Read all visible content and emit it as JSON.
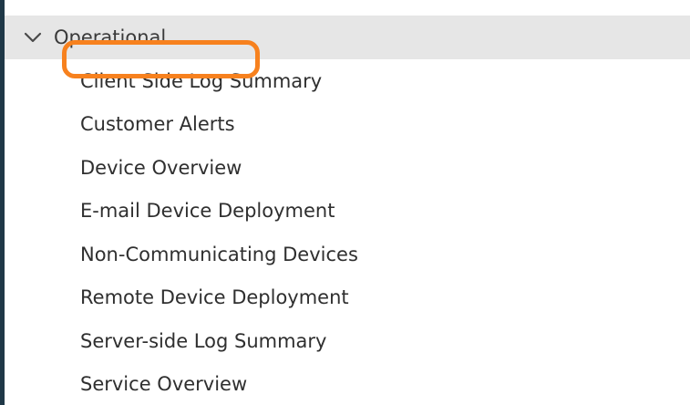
{
  "colors": {
    "header_background": "#e6e6e6",
    "left_edge": "#1f3847",
    "highlight": "#f7811e",
    "text": "#2f2f2f"
  },
  "section": {
    "title": "Operational",
    "expanded": true,
    "icon": "chevron-down-icon"
  },
  "reports": [
    {
      "label": "Client Side Log Summary",
      "highlighted": false
    },
    {
      "label": "Customer Alerts",
      "highlighted": true
    },
    {
      "label": "Device Overview",
      "highlighted": false
    },
    {
      "label": "E-mail Device Deployment",
      "highlighted": false
    },
    {
      "label": "Non-Communicating Devices",
      "highlighted": false
    },
    {
      "label": "Remote Device Deployment",
      "highlighted": false
    },
    {
      "label": "Server-side Log Summary",
      "highlighted": false
    },
    {
      "label": "Service Overview",
      "highlighted": false
    }
  ]
}
